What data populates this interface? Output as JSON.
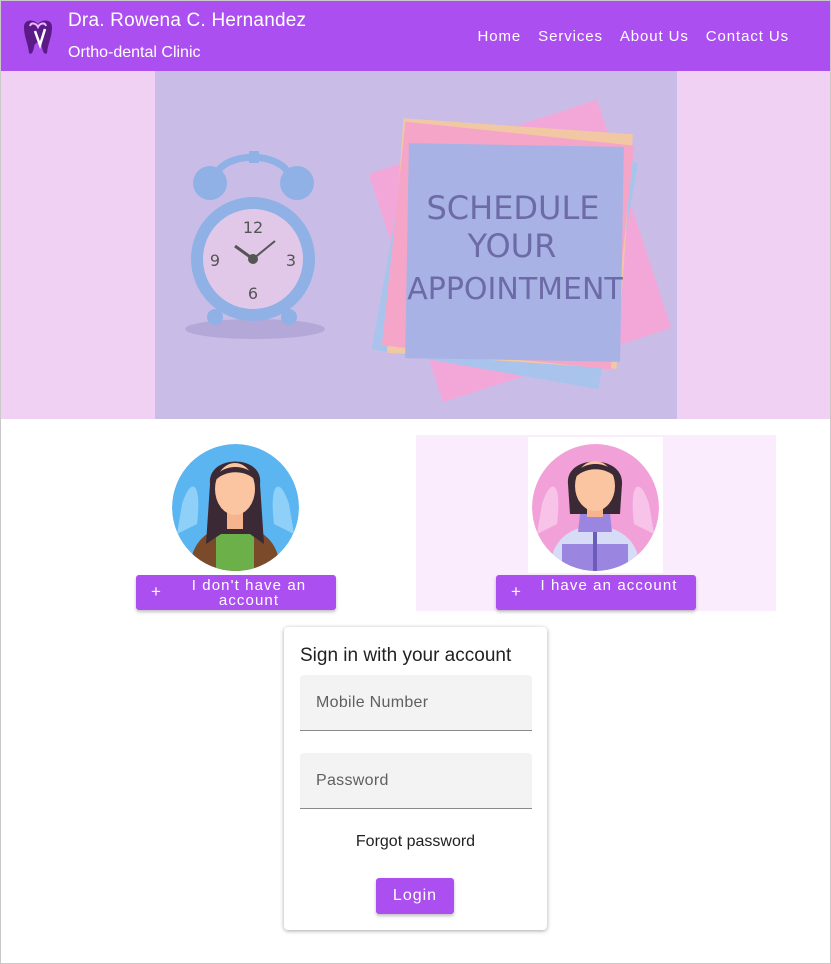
{
  "header": {
    "title": "Dra. Rowena C. Hernandez",
    "subtitle": "Ortho-dental Clinic",
    "logo_icon": "tooth-icon",
    "nav": [
      "Home",
      "Services",
      "About Us",
      "Contact Us"
    ],
    "color": "#ac4ff0"
  },
  "hero": {
    "image_text": [
      "SCHEDULE",
      "YOUR",
      "APPOINTMENT"
    ],
    "clock_numbers": [
      "12",
      "3",
      "6",
      "9"
    ]
  },
  "roles": {
    "new_user": {
      "label": "I don't have an account",
      "icon": "plus-icon"
    },
    "existing_user": {
      "label": "I have an account",
      "icon": "plus-icon"
    }
  },
  "signin": {
    "title": "Sign in with your account",
    "mobile_placeholder": "Mobile Number",
    "password_placeholder": "Password",
    "forgot": "Forgot password",
    "login": "Login"
  }
}
